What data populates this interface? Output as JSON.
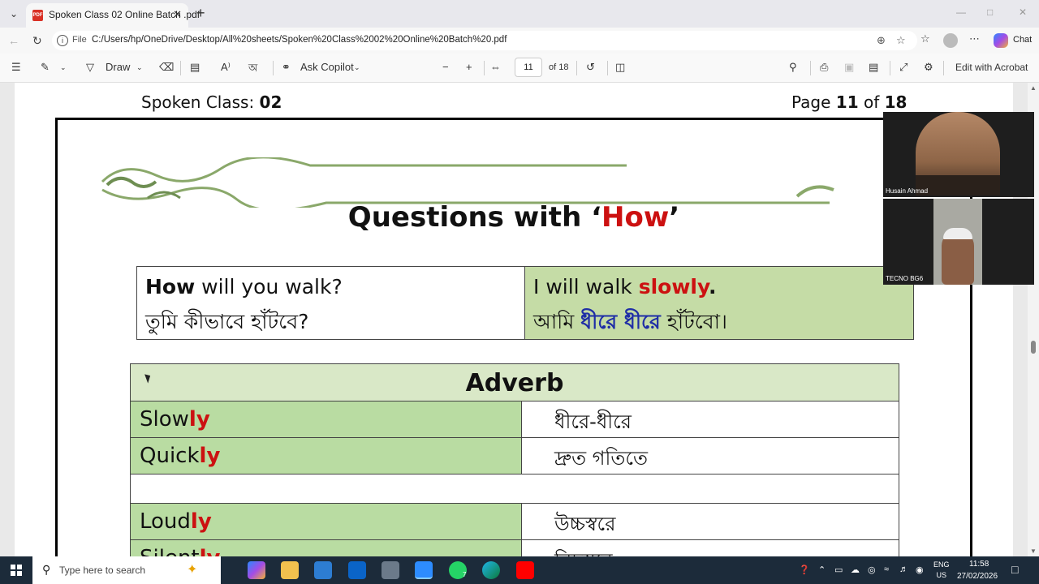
{
  "browser": {
    "tab_title": "Spoken Class 02 Online Batch .pdf",
    "file_label": "File",
    "url": "C:/Users/hp/OneDrive/Desktop/All%20sheets/Spoken%20Class%2002%20Online%20Batch%20.pdf",
    "chat_label": "Chat"
  },
  "pdf_toolbar": {
    "draw_label": "Draw",
    "ask_copilot_label": "Ask Copilot",
    "page_current": "11",
    "page_total": "of 18",
    "edit_acrobat_label": "Edit with Acrobat"
  },
  "page": {
    "header_left_prefix": "Spoken Class: ",
    "header_left_num": "02",
    "header_right_prefix": "Page ",
    "header_right_current": "11",
    "header_right_mid": " of ",
    "header_right_total": "18",
    "banner_title_pre": "Questions with ‘",
    "banner_title_red": "How",
    "banner_title_post": "’",
    "qa": {
      "q_bold": "How",
      "q_rest": " will you walk?",
      "q_bn": "তুমি কীভাবে হাঁটবে?",
      "a_pre": "I will walk ",
      "a_red": "slowly",
      "a_post": ".",
      "a_bn_pre": "আমি ",
      "a_bn_blue": "ধীরে ধীরে",
      "a_bn_post": " হাঁটবো।"
    },
    "adverb_heading": "Adverb",
    "adverbs": [
      {
        "stem": "Slow",
        "suffix": "ly",
        "bn": "ধীরে-ধীরে"
      },
      {
        "stem": "Quick",
        "suffix": "ly",
        "bn": "দ্রুত গতিতে"
      },
      {
        "stem": "Loud",
        "suffix": "ly",
        "bn": "উচ্চস্বরে"
      },
      {
        "stem": "Silent",
        "suffix": "ly",
        "bn": "নিচুস্বরে"
      }
    ]
  },
  "video": {
    "participant1": "Husain Ahmad",
    "participant2": "TECNO BG6"
  },
  "taskbar": {
    "search_placeholder": "Type here to search",
    "lang_top": "ENG",
    "lang_bottom": "US",
    "time": "11:58",
    "date": "27/02/2026",
    "whatsapp_badge": "7"
  },
  "colors": {
    "accent_red": "#cc1111",
    "accent_blue": "#1f2ea6",
    "green_cell": "#b9dca2"
  },
  "icons": [
    "pdf-icon",
    "close-icon",
    "plus-icon",
    "back-icon",
    "refresh-icon",
    "info-icon",
    "zoom-icon",
    "star-icon",
    "favorites-icon",
    "more-icon",
    "menu-icon",
    "highlighter-icon",
    "draw-icon",
    "eraser-icon",
    "text-icon",
    "read-aloud-icon",
    "translate-icon",
    "copilot-icon",
    "minus-icon",
    "fit-icon",
    "rotate-icon",
    "two-page-icon",
    "search-icon",
    "print-icon",
    "save-icon",
    "save-as-icon",
    "fullscreen-icon",
    "settings-icon",
    "windows-icon"
  ]
}
